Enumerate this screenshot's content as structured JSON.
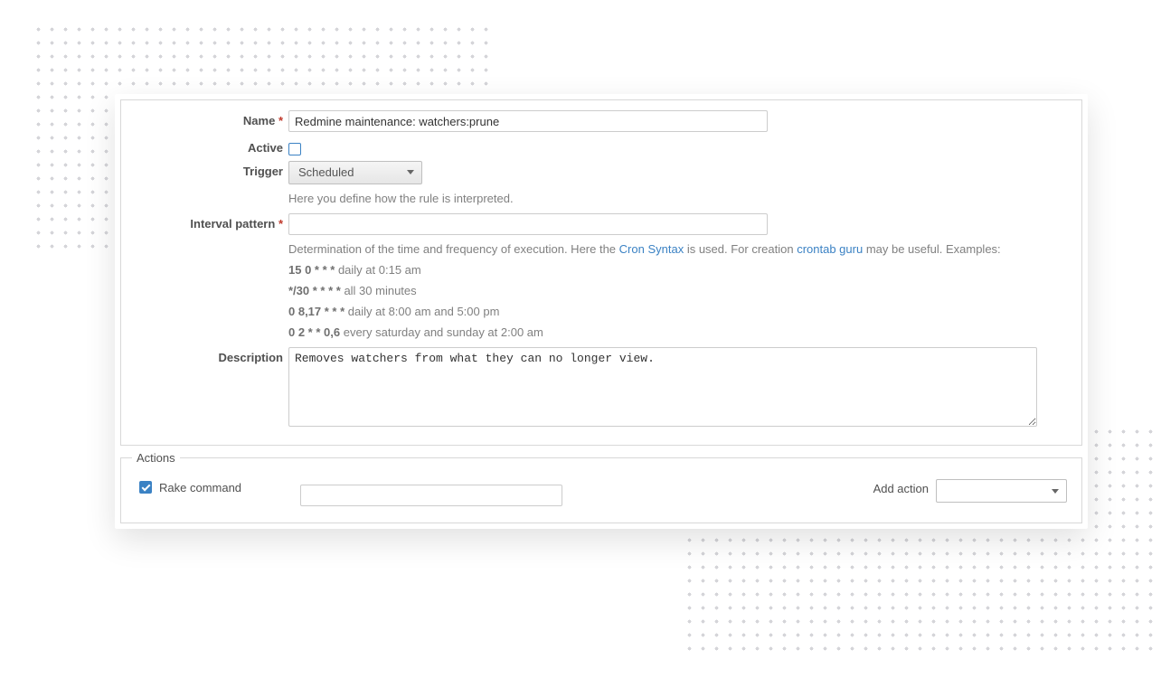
{
  "form": {
    "name": {
      "label": "Name",
      "value": "Redmine maintenance: watchers:prune"
    },
    "active": {
      "label": "Active",
      "checked": false
    },
    "trigger": {
      "label": "Trigger",
      "selected": "Scheduled",
      "hint": "Here you define how the rule is interpreted."
    },
    "interval": {
      "label": "Interval pattern",
      "value": "",
      "hint_pre": "Determination of the time and frequency of execution. Here the ",
      "link1": "Cron Syntax",
      "hint_mid": " is used. For creation ",
      "link2": "crontab guru",
      "hint_post": " may be useful. Examples:",
      "examples": [
        {
          "pattern": "15 0 * * *",
          "desc": " daily at 0:15 am"
        },
        {
          "pattern": "*/30 * * * *",
          "desc": " all 30 minutes"
        },
        {
          "pattern": "0 8,17 * * *",
          "desc": " daily at 8:00 am and 5:00 pm"
        },
        {
          "pattern": "0 2 * * 0,6",
          "desc": " every saturday and sunday at 2:00 am"
        }
      ]
    },
    "description": {
      "label": "Description",
      "value": "Removes watchers from what they can no longer view."
    }
  },
  "actions": {
    "legend": "Actions",
    "rake": {
      "label": "Rake command",
      "checked": true,
      "value": ""
    },
    "add_label": "Add action",
    "add_selected": ""
  }
}
